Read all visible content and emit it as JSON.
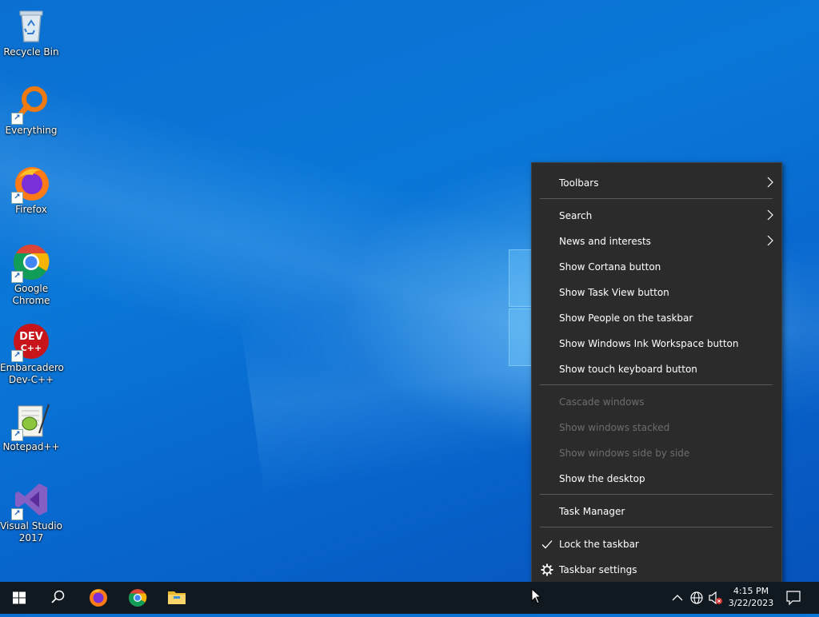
{
  "desktop": {
    "icons": [
      {
        "label": "Recycle Bin",
        "icon": "recycle-bin-icon"
      },
      {
        "label": "Everything",
        "icon": "everything-search-icon"
      },
      {
        "label": "Firefox",
        "icon": "firefox-icon"
      },
      {
        "label": "Google Chrome",
        "icon": "chrome-icon"
      },
      {
        "label": "Embarcadero Dev-C++",
        "icon": "devcpp-icon",
        "badge": "DEV C++"
      },
      {
        "label": "Notepad++",
        "icon": "notepadpp-icon"
      },
      {
        "label": "Visual Studio 2017",
        "icon": "visual-studio-icon"
      }
    ]
  },
  "context_menu": {
    "items": [
      {
        "label": "Toolbars",
        "submenu": true
      },
      {
        "label": "Search",
        "submenu": true
      },
      {
        "label": "News and interests",
        "submenu": true
      },
      {
        "label": "Show Cortana button"
      },
      {
        "label": "Show Task View button"
      },
      {
        "label": "Show People on the taskbar"
      },
      {
        "label": "Show Windows Ink Workspace button"
      },
      {
        "label": "Show touch keyboard button"
      },
      {
        "label": "Cascade windows",
        "disabled": true
      },
      {
        "label": "Show windows stacked",
        "disabled": true
      },
      {
        "label": "Show windows side by side",
        "disabled": true
      },
      {
        "label": "Show the desktop"
      },
      {
        "label": "Task Manager"
      },
      {
        "label": "Lock the taskbar",
        "checked": true
      },
      {
        "label": "Taskbar settings",
        "icon": "gear-icon"
      }
    ]
  },
  "taskbar": {
    "pinned": [
      "start-icon",
      "search-icon",
      "firefox-icon",
      "chrome-icon",
      "file-explorer-icon"
    ],
    "tray_icons": [
      "chevron-up-icon",
      "network-globe-icon",
      "volume-muted-icon"
    ],
    "clock": {
      "time": "4:15 PM",
      "date": "3/22/2023"
    }
  },
  "colors": {
    "menu_bg": "#2b2b2b",
    "menu_separator": "#5a5a5a",
    "disabled_text": "#6d6d6d",
    "taskbar_bg": "#101820"
  }
}
